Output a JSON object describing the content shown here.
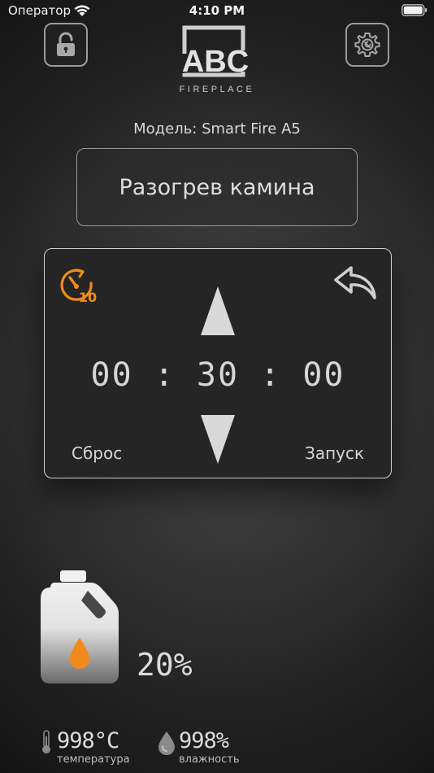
{
  "status_bar": {
    "carrier": "Оператор",
    "time": "4:10 PM",
    "wifi_icon": "wifi-icon",
    "battery_icon": "battery-icon"
  },
  "header": {
    "lock_icon": "unlock-icon",
    "settings_icon": "settings-gear-icon",
    "logo": {
      "main": "ABC",
      "sub": "FIREPLACE"
    }
  },
  "model": {
    "text": "Модель: Smart Fire A5"
  },
  "mode": {
    "label": "Разогрев камина"
  },
  "timer": {
    "icon": "timer-10-icon",
    "icon_number": "10",
    "back_icon": "back-arrow-icon",
    "display": "00 : 30 : 00",
    "reset_label": "Сброс",
    "start_label": "Запуск"
  },
  "fuel": {
    "icon": "fuel-canister-icon",
    "level_percent": 20,
    "percent_text": "20%"
  },
  "sensors": {
    "temperature": {
      "icon": "thermometer-icon",
      "value": "998°C",
      "label": "температура"
    },
    "humidity": {
      "icon": "humidity-drop-icon",
      "value": "998%",
      "label": "влажность"
    }
  },
  "colors": {
    "accent": "#f08a1c",
    "panel_border": "#d0d0d0",
    "text": "#dcdcdc"
  }
}
